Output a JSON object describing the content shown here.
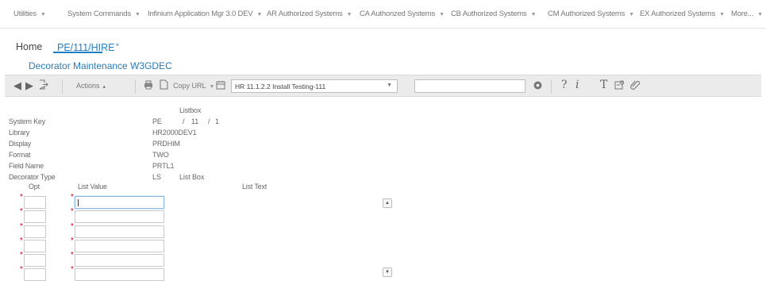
{
  "menu": {
    "items": [
      {
        "label": "Utilities"
      },
      {
        "label": "System Commands"
      },
      {
        "label": "Infinium Application Mgr 3.0 DEV"
      },
      {
        "label": "AR Authorized Systems"
      },
      {
        "label": "CA Authorized Systems"
      },
      {
        "label": "CB Authorized Systems"
      },
      {
        "label": "CM Authorized Systems"
      },
      {
        "label": "EX Authorized Systems"
      },
      {
        "label": "More..."
      }
    ]
  },
  "tabs": {
    "home": "Home",
    "active": "PE/111/HIRE",
    "close": "×"
  },
  "form": {
    "title": "Decorator Maintenance W3GDEC"
  },
  "toolbar": {
    "actions": "Actions",
    "copy_url": "Copy URL",
    "environment": "HR 11.1.2.2 Install Testing-111",
    "search_value": "",
    "icons": [
      "back-icon",
      "forward-icon",
      "exit-icon",
      "print-icon",
      "copy-icon",
      "calendar-icon",
      "go-icon",
      "help-icon",
      "info-icon",
      "text-icon",
      "settings-icon",
      "link-icon"
    ]
  },
  "header_fields": {
    "section_label": "Listbox",
    "system_key": {
      "label": "System Key",
      "v1": "PE",
      "sep1": "/",
      "v2": "11",
      "sep2": "/",
      "v3": "1"
    },
    "library": {
      "label": "Library",
      "value": "HR2000DEV1"
    },
    "display": {
      "label": "Display",
      "value": "PRDHIM"
    },
    "format": {
      "label": "Format",
      "value": "TWO"
    },
    "field_name": {
      "label": "Field Name",
      "value": "PRTL1"
    },
    "decorator_type": {
      "label": "Decorator Type",
      "value": "LS",
      "desc": "List Box"
    }
  },
  "grid": {
    "columns": {
      "opt": "Opt",
      "list_value": "List Value",
      "list_text": "List Text"
    },
    "required_mark": "*",
    "rows": [
      {
        "opt": "",
        "list_value": "",
        "list_text": ""
      },
      {
        "opt": "",
        "list_value": "",
        "list_text": ""
      },
      {
        "opt": "",
        "list_value": "",
        "list_text": ""
      },
      {
        "opt": "",
        "list_value": "",
        "list_text": ""
      },
      {
        "opt": "",
        "list_value": "",
        "list_text": ""
      },
      {
        "opt": "",
        "list_value": "",
        "list_text": ""
      }
    ]
  },
  "colors": {
    "accent": "#1e7fc8",
    "title": "#2a7ab8",
    "required": "#d0021b",
    "toolbar_bg": "#ebebeb"
  }
}
